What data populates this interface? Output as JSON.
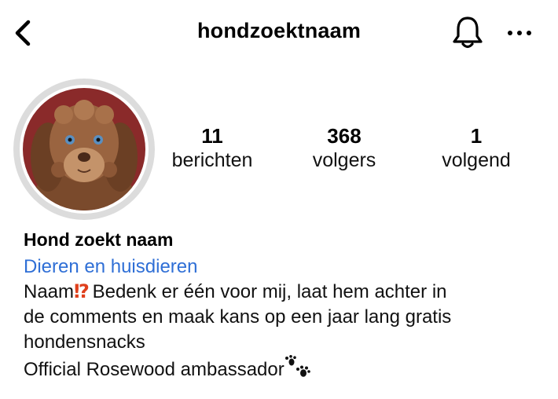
{
  "header": {
    "title": "hondzoektnaam",
    "back_icon": "chevron-left-icon",
    "bell_icon": "bell-icon",
    "more_icon": "more-horizontal-icon"
  },
  "profile": {
    "avatar_icon": "dog-avatar",
    "stats": [
      {
        "value": "11",
        "label": "berichten"
      },
      {
        "value": "368",
        "label": "volgers"
      },
      {
        "value": "1",
        "label": "volgend"
      }
    ]
  },
  "bio": {
    "name": "Hond zoekt naam",
    "category": "Dieren en huisdieren",
    "line1_prefix": "Naam",
    "line1_emoji": "⁉",
    "line1_rest": " Bedenk er één voor mij, laat hem achter in",
    "line2": "de comments en maak kans op een jaar lang gratis",
    "line3": "hondensnacks",
    "line4": "Official Rosewood ambassador",
    "line4_icon": "paw-prints-icon"
  },
  "colors": {
    "link": "#2f6fd6",
    "avatar_bg": "#8a2a2a",
    "ring": "#dcdcdc",
    "emoji": "#e0401c"
  }
}
